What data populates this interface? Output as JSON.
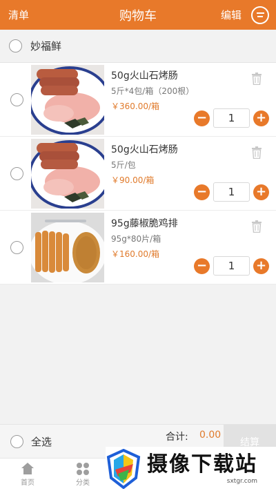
{
  "header": {
    "left_label": "清单",
    "title": "购物车",
    "edit_label": "编辑",
    "message_icon": "chat-icon"
  },
  "shop": {
    "name": "妙福鲜"
  },
  "items": [
    {
      "name": "50g火山石烤肠",
      "spec": "5斤*4包/箱（200根）",
      "price": "￥360.00/箱",
      "qty": "1",
      "image": "sausage-plate"
    },
    {
      "name": "50g火山石烤肠",
      "spec": "5斤/包",
      "price": "￥90.00/箱",
      "qty": "1",
      "image": "sausage-plate"
    },
    {
      "name": "95g藤椒脆鸡排",
      "spec": "95g*80片/箱",
      "price": "￥160.00/箱",
      "qty": "1",
      "image": "chicken-cutlet-plate"
    }
  ],
  "stepper": {
    "minus": "−",
    "plus": "+"
  },
  "footer": {
    "select_all": "全选",
    "total_label": "合计:",
    "total_value": "0.00",
    "checkout_label": "结算"
  },
  "tabbar": {
    "home": "首页",
    "category": "分类"
  },
  "watermark": {
    "title": "摄像下载站",
    "url": "sxtgr.com"
  },
  "colors": {
    "accent": "#e8792a",
    "price": "#e07a2b"
  }
}
